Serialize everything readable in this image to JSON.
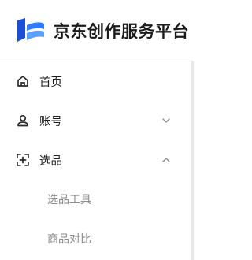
{
  "brand": {
    "title": "京东创作服务平台",
    "logo_icon": "jd-logo-icon",
    "accent": "#1a6bff"
  },
  "nav": {
    "items": [
      {
        "label": "首页",
        "icon": "home-icon"
      },
      {
        "label": "账号",
        "icon": "user-icon",
        "expanded": false
      },
      {
        "label": "选品",
        "icon": "select-product-icon",
        "expanded": true,
        "children": [
          {
            "label": "选品工具"
          },
          {
            "label": "商品对比"
          }
        ]
      }
    ]
  }
}
